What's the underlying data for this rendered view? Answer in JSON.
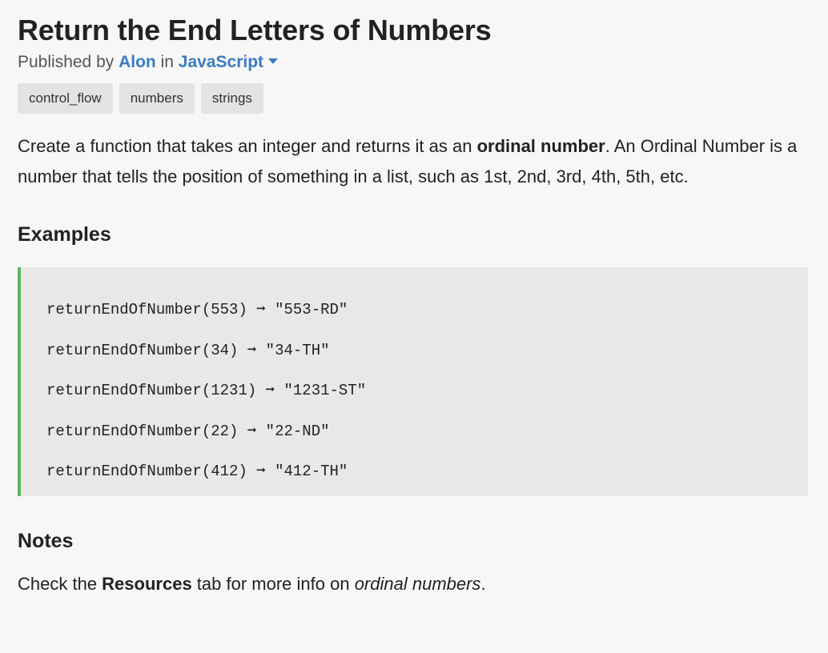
{
  "challenge": {
    "title": "Return the End Letters of Numbers",
    "byline": {
      "prefix": "Published by",
      "author": "Alon",
      "middle": "in",
      "language": "JavaScript",
      "caret_icon": "caret-down-icon"
    },
    "tags": [
      "control_flow",
      "numbers",
      "strings"
    ]
  },
  "description": {
    "part1": "Create a function that takes an integer and returns it as an ",
    "bold": "ordinal number",
    "part2": ". An Ordinal Number is a number that tells the position of something in a list, such as 1st, 2nd, 3rd, 4th, 5th, etc."
  },
  "examples": {
    "heading": "Examples",
    "lines": [
      "returnEndOfNumber(553) ➞ \"553-RD\"",
      "returnEndOfNumber(34) ➞ \"34-TH\"",
      "returnEndOfNumber(1231) ➞ \"1231-ST\"",
      "returnEndOfNumber(22) ➞ \"22-ND\"",
      "returnEndOfNumber(412) ➞ \"412-TH\""
    ]
  },
  "notes": {
    "heading": "Notes",
    "part1": "Check the ",
    "bold": "Resources",
    "part2": " tab for more info on ",
    "italic": "ordinal numbers",
    "part3": "."
  },
  "colors": {
    "background": "#f7f7f7",
    "link": "#3a7cc1",
    "tag_bg": "#e3e3e3",
    "code_bg": "#e8e8e8",
    "code_border": "#5cb85c"
  }
}
